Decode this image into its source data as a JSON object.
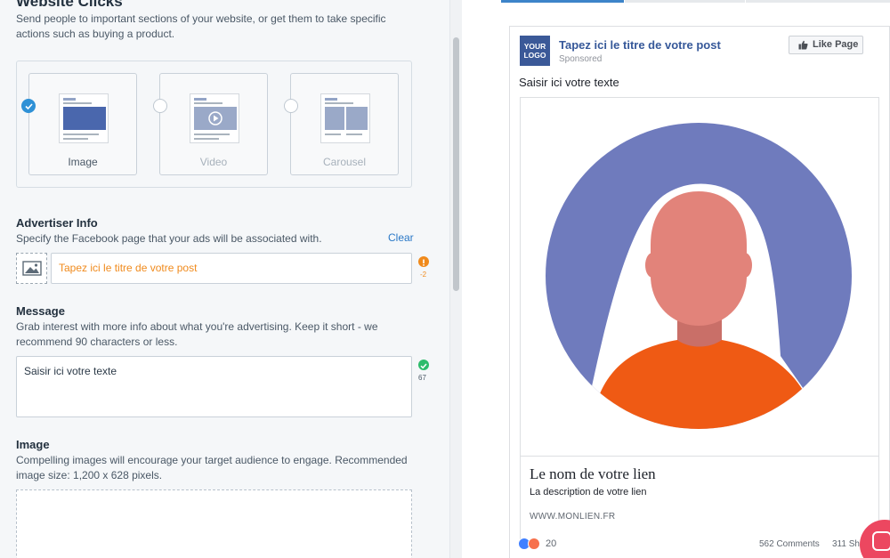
{
  "editor": {
    "page_title": "Website Clicks",
    "page_desc": "Send people to important sections of your website, or get them to take specific actions such as buying a product.",
    "formats": [
      {
        "label": "Image",
        "selected": true
      },
      {
        "label": "Video",
        "selected": false
      },
      {
        "label": "Carousel",
        "selected": false
      }
    ],
    "advertiser": {
      "title": "Advertiser Info",
      "desc": "Specify the Facebook page that your ads will be associated with.",
      "clear_label": "Clear",
      "input_value": "Tapez ici le titre de votre post",
      "status_count": "-2",
      "status_color": "#f08a1c"
    },
    "message": {
      "title": "Message",
      "desc": "Grab interest with more info about what you're advertising. Keep it short - we recommend 90 characters or less.",
      "input_value": "Saisir ici votre texte",
      "status_count": "67",
      "status_color": "#2ebc6c"
    },
    "image": {
      "title": "Image",
      "desc": "Compelling images will encourage your target audience to engage. Recommended image size: 1,200 x 628 pixels."
    }
  },
  "preview": {
    "logo_text": "YOUR LOGO",
    "post_title": "Tapez ici le titre de votre post",
    "sponsored": "Sponsored",
    "like_page_label": "Like Page",
    "post_text": "Saisir ici votre texte",
    "link_name": "Le nom de votre lien",
    "link_description": "La description de votre lien",
    "link_url": "WWW.MONLIEN.FR",
    "reaction_count": "20",
    "comments": "562 Comments",
    "shares": "311 Sh",
    "brand_color": "#3b5998",
    "placeholder_colors": {
      "circle": "#6f7bbd",
      "hair": "#ffffff",
      "skin": "#e2837a",
      "shirt": "#ef5a14"
    }
  }
}
